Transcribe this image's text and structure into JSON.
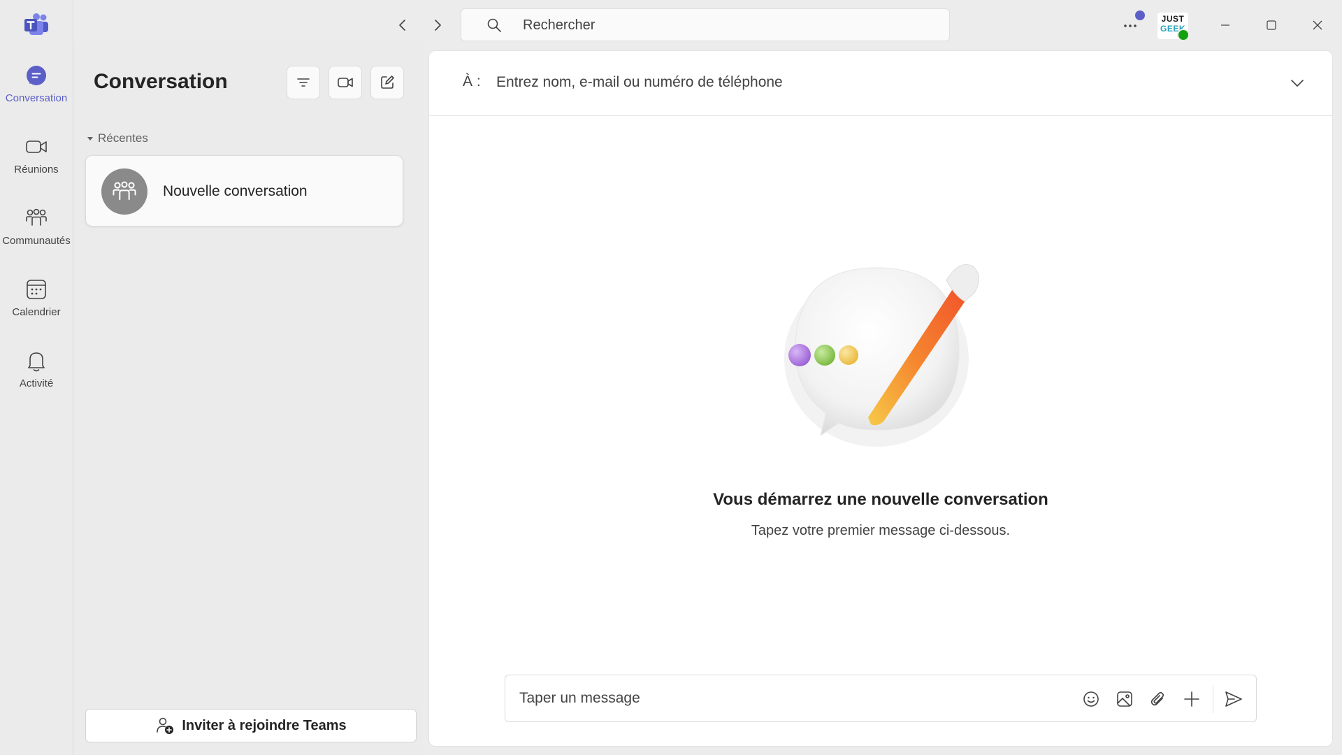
{
  "colors": {
    "accent": "#5b5fc7",
    "presence_available": "#13a10e",
    "background": "#ececec",
    "panel": "#ffffff"
  },
  "rail": {
    "items": [
      {
        "label": "Conversation",
        "icon": "chat-icon",
        "active": true
      },
      {
        "label": "Réunions",
        "icon": "video-camera-icon",
        "active": false
      },
      {
        "label": "Communautés",
        "icon": "people-community-icon",
        "active": false
      },
      {
        "label": "Calendrier",
        "icon": "calendar-icon",
        "active": false
      },
      {
        "label": "Activité",
        "icon": "bell-icon",
        "active": false
      }
    ]
  },
  "header": {
    "search_placeholder": "Rechercher",
    "avatar_initials_line1": "JUST",
    "avatar_initials_line2": "GEEK"
  },
  "list": {
    "title": "Conversation",
    "section_label": "Récentes",
    "recent": [
      {
        "name": "Nouvelle conversation",
        "icon": "group-icon"
      }
    ],
    "invite_label": "Inviter à rejoindre Teams"
  },
  "compose": {
    "to_label": "À :",
    "to_placeholder": "Entrez nom, e-mail ou numéro de téléphone",
    "empty_title": "Vous démarrez une nouvelle conversation",
    "empty_subtitle": "Tapez votre premier message ci-dessous.",
    "message_placeholder": "Taper un message"
  }
}
